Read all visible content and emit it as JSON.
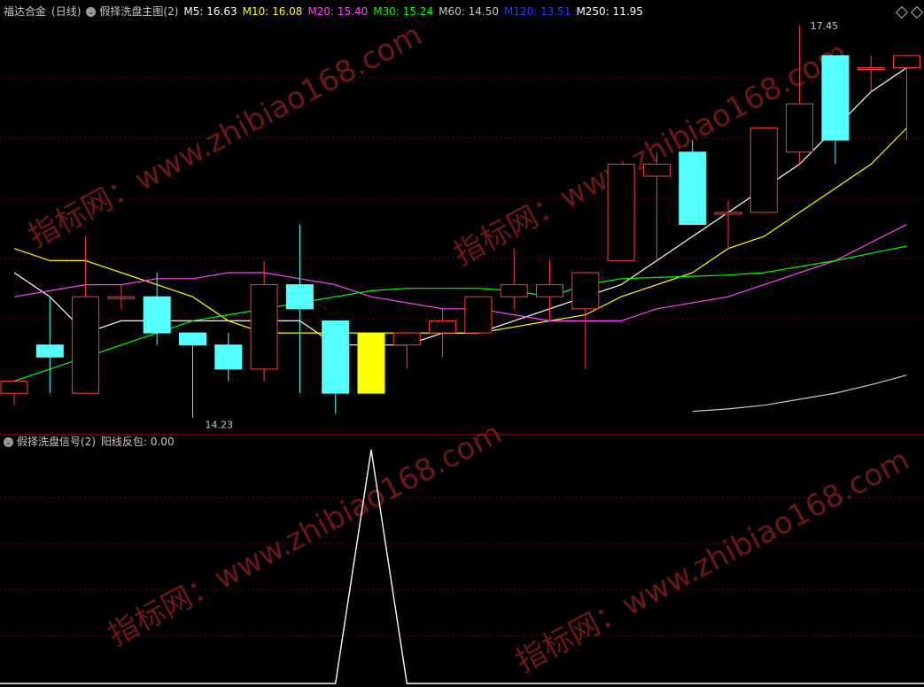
{
  "header_main": {
    "instrument": "福达合金",
    "period": "(日线)",
    "indicator": "假择洗盘主图(2)",
    "ma_items": [
      {
        "label": "M5: 16.63",
        "color": "#ffffff"
      },
      {
        "label": "M10: 16.08",
        "color": "#ffff00"
      },
      {
        "label": "M20: 15.40",
        "color": "#ff44ff"
      },
      {
        "label": "M30: 15.24",
        "color": "#00ff00"
      },
      {
        "label": "M60: 14.50",
        "color": "#c8c8c8"
      },
      {
        "label": "M120: 13.51",
        "color": "#2a3cff"
      },
      {
        "label": "M250: 11.95",
        "color": "#ffffff"
      }
    ]
  },
  "header_sub": {
    "indicator": "假择洗盘信号(2)",
    "signal_label": "阳线反包: 0.00",
    "signal_color": "#ffffff"
  },
  "annotations": {
    "high_label": "17.45",
    "low_label": "14.23"
  },
  "watermark": {
    "text": "指标网：www.zhibiao168.com",
    "color": "#7a1a1a"
  },
  "colors": {
    "up": "#ff3c3c",
    "down": "#54ffff",
    "signal_candle": "#ffff00",
    "separator": "#c00000",
    "grid": "#7a0000"
  },
  "chart_data": {
    "type": "candlestick",
    "candles": [
      {
        "o": 14.4,
        "h": 14.5,
        "l": 14.3,
        "c": 14.5
      },
      {
        "o": 14.8,
        "h": 15.2,
        "l": 14.4,
        "c": 14.7
      },
      {
        "o": 14.4,
        "h": 15.7,
        "l": 14.4,
        "c": 15.2
      },
      {
        "o": 15.2,
        "h": 15.3,
        "l": 15.1,
        "c": 15.2
      },
      {
        "o": 15.2,
        "h": 15.4,
        "l": 14.8,
        "c": 14.9
      },
      {
        "o": 14.9,
        "h": 14.9,
        "l": 14.2,
        "c": 14.8
      },
      {
        "o": 14.8,
        "h": 14.9,
        "l": 14.5,
        "c": 14.6
      },
      {
        "o": 14.6,
        "h": 15.5,
        "l": 14.5,
        "c": 15.3
      },
      {
        "o": 15.3,
        "h": 15.8,
        "l": 14.4,
        "c": 15.1
      },
      {
        "o": 15.0,
        "h": 15.0,
        "l": 14.23,
        "c": 14.4
      },
      {
        "o": 14.4,
        "h": 14.9,
        "l": 14.4,
        "c": 14.9
      },
      {
        "o": 14.8,
        "h": 14.9,
        "l": 14.6,
        "c": 14.9
      },
      {
        "o": 14.9,
        "h": 15.1,
        "l": 14.7,
        "c": 15.0
      },
      {
        "o": 14.9,
        "h": 15.2,
        "l": 14.9,
        "c": 15.2
      },
      {
        "o": 15.2,
        "h": 15.6,
        "l": 15.1,
        "c": 15.3
      },
      {
        "o": 15.2,
        "h": 15.5,
        "l": 15.0,
        "c": 15.3
      },
      {
        "o": 15.1,
        "h": 15.4,
        "l": 14.6,
        "c": 15.4
      },
      {
        "o": 15.5,
        "h": 16.1,
        "l": 15.5,
        "c": 16.3
      },
      {
        "o": 16.2,
        "h": 16.4,
        "l": 15.5,
        "c": 16.3
      },
      {
        "o": 16.4,
        "h": 16.5,
        "l": 16.0,
        "c": 15.8
      },
      {
        "o": 15.9,
        "h": 16.0,
        "l": 15.6,
        "c": 15.9
      },
      {
        "o": 15.9,
        "h": 16.5,
        "l": 15.9,
        "c": 16.6
      },
      {
        "o": 16.4,
        "h": 17.45,
        "l": 16.3,
        "c": 16.8
      },
      {
        "o": 17.2,
        "h": 17.1,
        "l": 16.3,
        "c": 16.5
      },
      {
        "o": 17.1,
        "h": 17.2,
        "l": 16.9,
        "c": 17.1
      },
      {
        "o": 17.1,
        "h": 17.2,
        "l": 16.5,
        "c": 17.2
      }
    ],
    "signal_candle_index": 10,
    "ma_lines": [
      {
        "name": "M5",
        "color": "#ffffff",
        "start": 0,
        "values": [
          15.4,
          15.2,
          14.9,
          15.0,
          15.0,
          15.0,
          15.0,
          15.0,
          15.0,
          14.8,
          14.8,
          14.8,
          14.9,
          14.9,
          15.0,
          15.1,
          15.2,
          15.3,
          15.5,
          15.7,
          15.9,
          16.1,
          16.3,
          16.6,
          16.9,
          17.1
        ]
      },
      {
        "name": "M10",
        "color": "#ffff00",
        "start": 0,
        "values": [
          15.6,
          15.5,
          15.5,
          15.4,
          15.3,
          15.2,
          15.0,
          14.9,
          14.9,
          14.9,
          14.9,
          14.9,
          14.9,
          14.9,
          14.95,
          15.0,
          15.05,
          15.2,
          15.3,
          15.4,
          15.6,
          15.7,
          15.9,
          16.1,
          16.3,
          16.6
        ]
      },
      {
        "name": "M20",
        "color": "#ff44ff",
        "start": 0,
        "values": [
          15.2,
          15.25,
          15.3,
          15.3,
          15.35,
          15.35,
          15.4,
          15.4,
          15.35,
          15.3,
          15.2,
          15.15,
          15.1,
          15.1,
          15.05,
          15.0,
          15.0,
          15.0,
          15.1,
          15.15,
          15.2,
          15.3,
          15.4,
          15.5,
          15.65,
          15.8
        ]
      },
      {
        "name": "M30",
        "color": "#00ff00",
        "start": 0,
        "values": [
          14.5,
          14.6,
          14.7,
          14.8,
          14.9,
          15.0,
          15.05,
          15.1,
          15.15,
          15.2,
          15.25,
          15.27,
          15.27,
          15.27,
          15.25,
          15.2,
          15.3,
          15.35,
          15.36,
          15.37,
          15.38,
          15.4,
          15.45,
          15.5,
          15.56,
          15.62
        ]
      },
      {
        "name": "M250",
        "color": "#c8c8c8",
        "start": 19,
        "values": [
          14.25,
          14.27,
          14.3,
          14.35,
          14.4,
          14.47,
          14.55
        ]
      }
    ],
    "signal_series": {
      "name": "阳线反包",
      "values": [
        0,
        0,
        0,
        0,
        0,
        0,
        0,
        0,
        0,
        0,
        1,
        0,
        0,
        0,
        0,
        0,
        0,
        0,
        0,
        0,
        0,
        0,
        0,
        0,
        0,
        0
      ]
    },
    "y_range_main": [
      14.1,
      17.5
    ],
    "y_range_signal": [
      0,
      1
    ]
  }
}
